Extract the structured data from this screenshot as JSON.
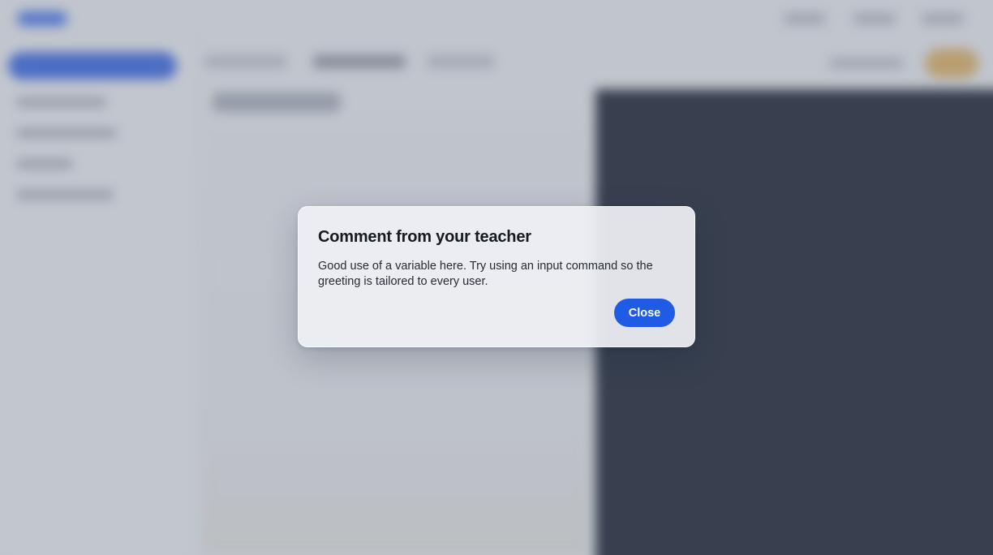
{
  "dialog": {
    "title": "Comment from your teacher",
    "body": "Good use of a variable here. Try using an input command so the greeting is tailored to every user.",
    "close_label": "Close"
  },
  "colors": {
    "primary": "#1f5be5",
    "accent": "#e7b25a",
    "console_bg": "#0a1120"
  }
}
